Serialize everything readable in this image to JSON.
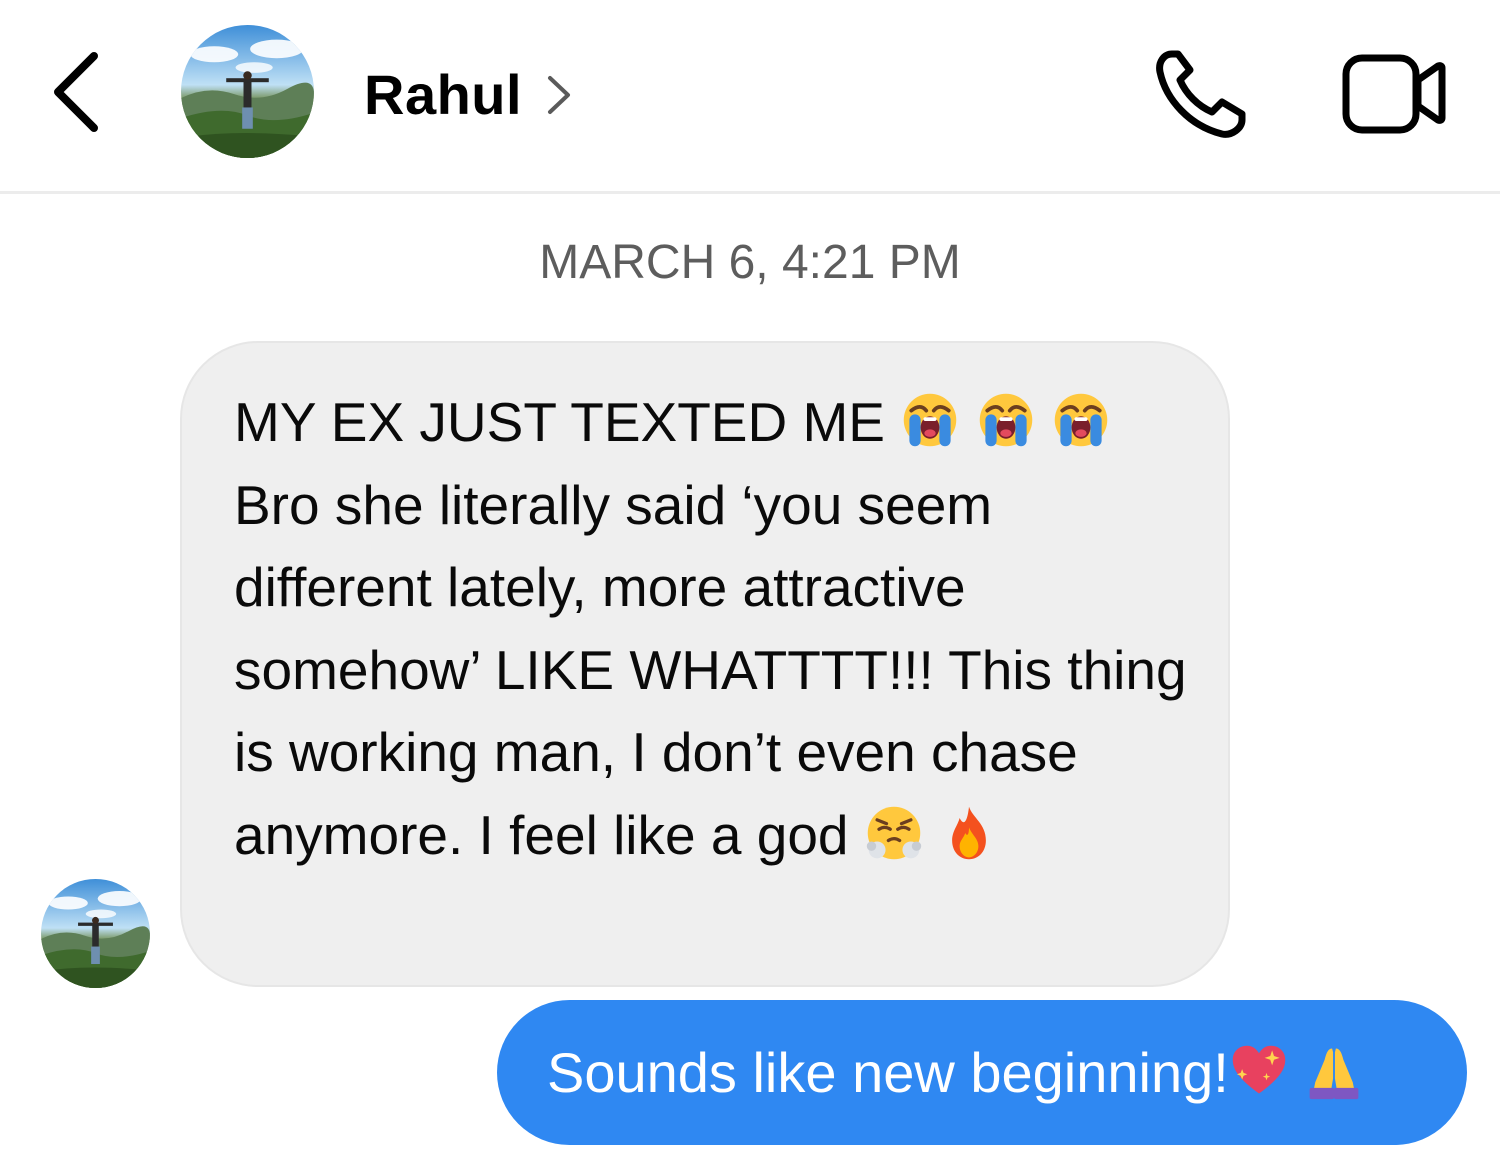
{
  "header": {
    "contact_name": "Rahul",
    "icons": {
      "back": "chevron-left-icon",
      "profile_link": "chevron-right-icon",
      "call": "phone-icon",
      "video": "video-camera-icon"
    }
  },
  "conversation": {
    "timestamp": "MARCH 6, 4:21 PM",
    "incoming": {
      "line1": "MY EX JUST TEXTED ME",
      "line2_text": "Bro she literally said ‘you seem",
      "body": "different lately, more attractive somehow’ LIKE WHATTTT!!! This thing is working man, I don’t even chase anymore. I feel like a god",
      "emojis": [
        "loudly-crying-face",
        "loudly-crying-face",
        "loudly-crying-face",
        "face-with-steam-from-nose",
        "fire"
      ]
    },
    "outgoing": {
      "text": "Sounds like new beginning!",
      "emojis": [
        "sparkling-heart",
        "folded-hands"
      ]
    }
  },
  "colors": {
    "outgoing_bubble": "#2f88f2",
    "incoming_bubble": "#efefef",
    "timestamp": "#5d5d5d",
    "divider": "#ececec"
  }
}
